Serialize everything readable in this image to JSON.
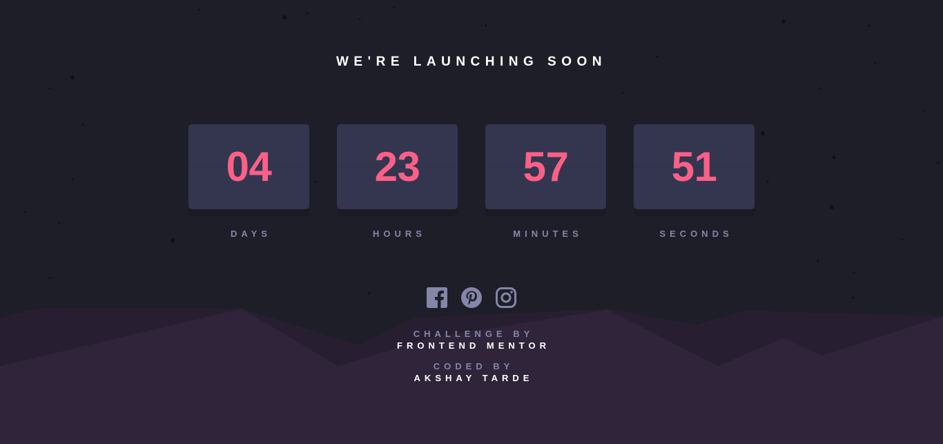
{
  "page": {
    "title": "WE'RE LAUNCHING SOON"
  },
  "countdown": [
    {
      "value": "04",
      "label": "DAYS"
    },
    {
      "value": "23",
      "label": "HOURS"
    },
    {
      "value": "57",
      "label": "MINUTES"
    },
    {
      "value": "51",
      "label": "SECONDS"
    }
  ],
  "socials": [
    {
      "name": "facebook-icon"
    },
    {
      "name": "pinterest-icon"
    },
    {
      "name": "instagram-icon"
    }
  ],
  "credits": {
    "challenge_label": "CHALLENGE BY",
    "challenge_name": "FRONTEND MENTOR",
    "coded_label": "CODED BY",
    "coded_name": "AKSHAY TARDE"
  },
  "colors": {
    "background": "#1e1e28",
    "hills": "#2f2439",
    "hills_dark": "#1b1922",
    "card": "#343650",
    "number": "#fb6087",
    "label": "#8486a9"
  }
}
